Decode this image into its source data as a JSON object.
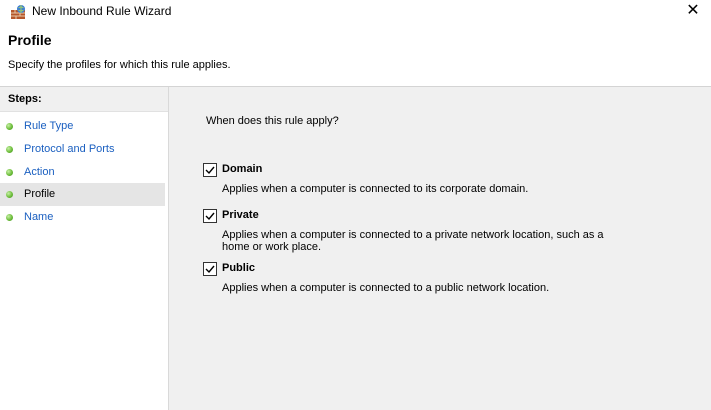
{
  "window": {
    "title": "New Inbound Rule Wizard",
    "close_glyph": "✕"
  },
  "header": {
    "title": "Profile",
    "subtitle": "Specify the profiles for which this rule applies."
  },
  "sidebar": {
    "steps_label": "Steps:",
    "items": [
      {
        "label": "Rule Type",
        "selected": false
      },
      {
        "label": "Protocol and Ports",
        "selected": false
      },
      {
        "label": "Action",
        "selected": false
      },
      {
        "label": "Profile",
        "selected": true
      },
      {
        "label": "Name",
        "selected": false
      }
    ]
  },
  "main": {
    "question": "When does this rule apply?",
    "options": [
      {
        "label": "Domain",
        "checked": true,
        "description": "Applies when a computer is connected to its corporate domain."
      },
      {
        "label": "Private",
        "checked": true,
        "description": "Applies when a computer is connected to a private network location, such as a home or work place."
      },
      {
        "label": "Public",
        "checked": true,
        "description": "Applies when a computer is connected to a public network location."
      }
    ]
  },
  "colors": {
    "link": "#1a5fc0",
    "content_bg": "#f0f0f0",
    "selected_step_bg": "#e5e5e5"
  }
}
